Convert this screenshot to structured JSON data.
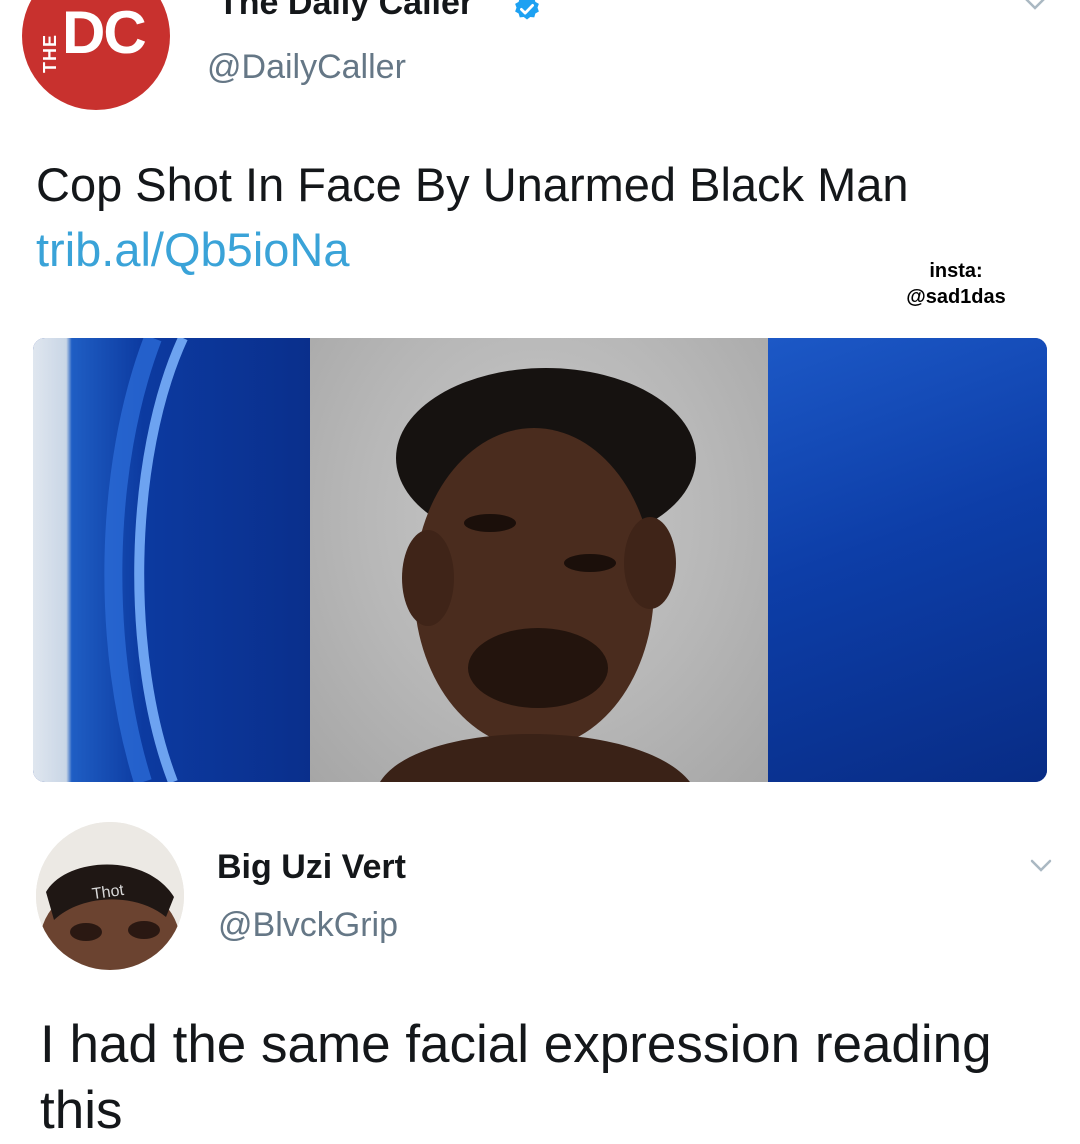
{
  "tweet": {
    "account_name": "The Daily Caller",
    "handle": "@DailyCaller",
    "avatar": {
      "small_text": "THE",
      "letters": "DC",
      "background_color": "#c8312e"
    },
    "verified_icon": "verified-badge-icon",
    "menu_icon": "chevron-down-icon",
    "text": "Cop Shot In Face By Unarmed Black Man",
    "link": "trib.al/Qb5ioNa",
    "link_color": "#3aa3d8"
  },
  "watermark": {
    "line1": "insta:",
    "line2": "@sad1das"
  },
  "reply": {
    "account_name": "Big Uzi Vert",
    "handle": "@BlvckGrip",
    "avatar_label": "Thot",
    "menu_icon": "chevron-down-icon",
    "text": "I had the same facial expression reading this"
  },
  "colors": {
    "text": "#14171a",
    "secondary_text": "#657786",
    "verified": "#1da1f2",
    "news_blue": "#0b2d8e"
  }
}
